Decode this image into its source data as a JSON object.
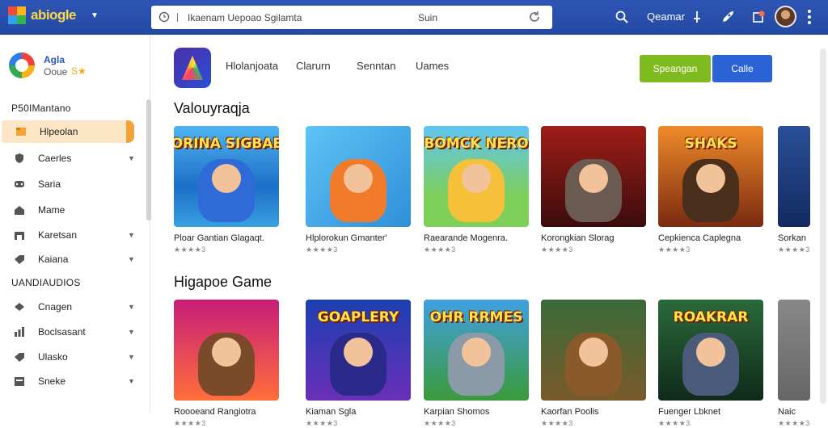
{
  "header": {
    "brand": "abiogle",
    "search_text": "Ikaenam Uepoao Sgilamta",
    "search_right": "Suin",
    "user_label": "Qeamar",
    "colors": {
      "bar": "#2a50ad",
      "accent": "#ffd84a"
    }
  },
  "sidebar": {
    "brand_line1": "Agla",
    "brand_line2": "Ooue",
    "brand_star": "S★",
    "section1": "P50IMantano",
    "items": [
      {
        "label": "Hlpeolan",
        "icon": "folder-icon",
        "active": true,
        "chevron": false
      },
      {
        "label": "Caerles",
        "icon": "shield-icon",
        "chevron": true
      },
      {
        "label": "Saria",
        "icon": "gamepad-icon",
        "chevron": false
      },
      {
        "label": "Mame",
        "icon": "home-icon",
        "chevron": false
      },
      {
        "label": "Karetsan",
        "icon": "store-icon",
        "chevron": true
      },
      {
        "label": "Kaiana",
        "icon": "tag-icon",
        "chevron": true
      }
    ],
    "section2": "UANDIAUDIOS",
    "items2": [
      {
        "label": "Cnagen",
        "icon": "diamond-icon",
        "chevron": true
      },
      {
        "label": "Boclsasant",
        "icon": "chart-icon",
        "chevron": true
      },
      {
        "label": "Ulasko",
        "icon": "tag-icon",
        "chevron": true
      },
      {
        "label": "Sneke",
        "icon": "box-icon",
        "chevron": true
      }
    ]
  },
  "main": {
    "tabs": [
      "Hlolanjoata",
      "Clarurn",
      "Senntan",
      "Uames"
    ],
    "btn_primary": "Speangan",
    "btn_secondary": "Calle",
    "section1_title": "Valouyraqja",
    "section1_cards": [
      {
        "badge": "RORINA SIGBAEP",
        "title": "Ploar Gantian Glagaqt.",
        "rating": "★★★★3"
      },
      {
        "badge": "",
        "title": "Hlplorokun Gmanter'",
        "rating": "★★★★3"
      },
      {
        "badge": "BOMCK NERO",
        "title": "Raearande Mogenra.",
        "rating": "★★★★3"
      },
      {
        "badge": "",
        "title": "Korongkian Slorag",
        "rating": "★★★★3"
      },
      {
        "badge": "SHAKS",
        "title": "Cepkienca Caplegna",
        "rating": "★★★★3"
      },
      {
        "badge": "",
        "title": "Sorkan",
        "rating": "★★★★3"
      }
    ],
    "section2_title": "Higapoe Game",
    "section2_cards": [
      {
        "badge": "",
        "title": "Roooeand Rangiotra",
        "rating": "★★★★3"
      },
      {
        "badge": "GOAPLERY",
        "title": "Kiaman Sgla",
        "rating": "★★★★3"
      },
      {
        "badge": "OHR RRMES",
        "title": "Karpian Shomos",
        "rating": "★★★★3"
      },
      {
        "badge": "",
        "title": "Kaorfan Poolis",
        "rating": "★★★★3"
      },
      {
        "badge": "ROAKRAR",
        "title": "Fuenger Lbknet",
        "rating": "★★★★3"
      },
      {
        "badge": "",
        "title": "Naic",
        "rating": "★★★★3"
      }
    ]
  }
}
